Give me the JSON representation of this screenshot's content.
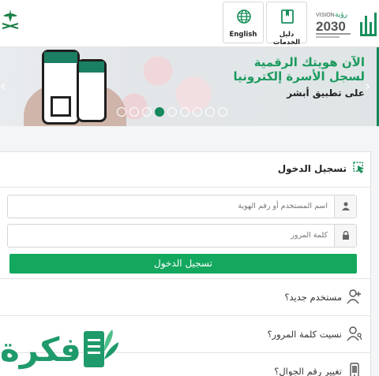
{
  "header": {
    "english_label": "English",
    "services_guide_label": "دليل الخدمات",
    "vision_label": "رؤية",
    "vision_year": "2030",
    "vision_en": "VISION"
  },
  "banner": {
    "line1": "الآن هويتك الرقمية",
    "line2": "لسجل الأسرة إلكترونيا",
    "line3": "على تطبيق أبشر",
    "slides_total": 9,
    "active_slide": 3
  },
  "login": {
    "title": "تسجيل الدخول",
    "username_placeholder": "اسم المستخدم أو رقم الهوية",
    "password_placeholder": "كلمة المرور",
    "submit_label": "تسجيل الدخول"
  },
  "links": {
    "new_user": "مستخدم جديد؟",
    "forgot_password": "نسيت كلمة المرور؟",
    "change_mobile": "تغيير رقم الجوال؟"
  },
  "watermark": {
    "text": "فكرة"
  },
  "colors": {
    "brand_green": "#14a85f",
    "dark_green": "#17885d"
  }
}
